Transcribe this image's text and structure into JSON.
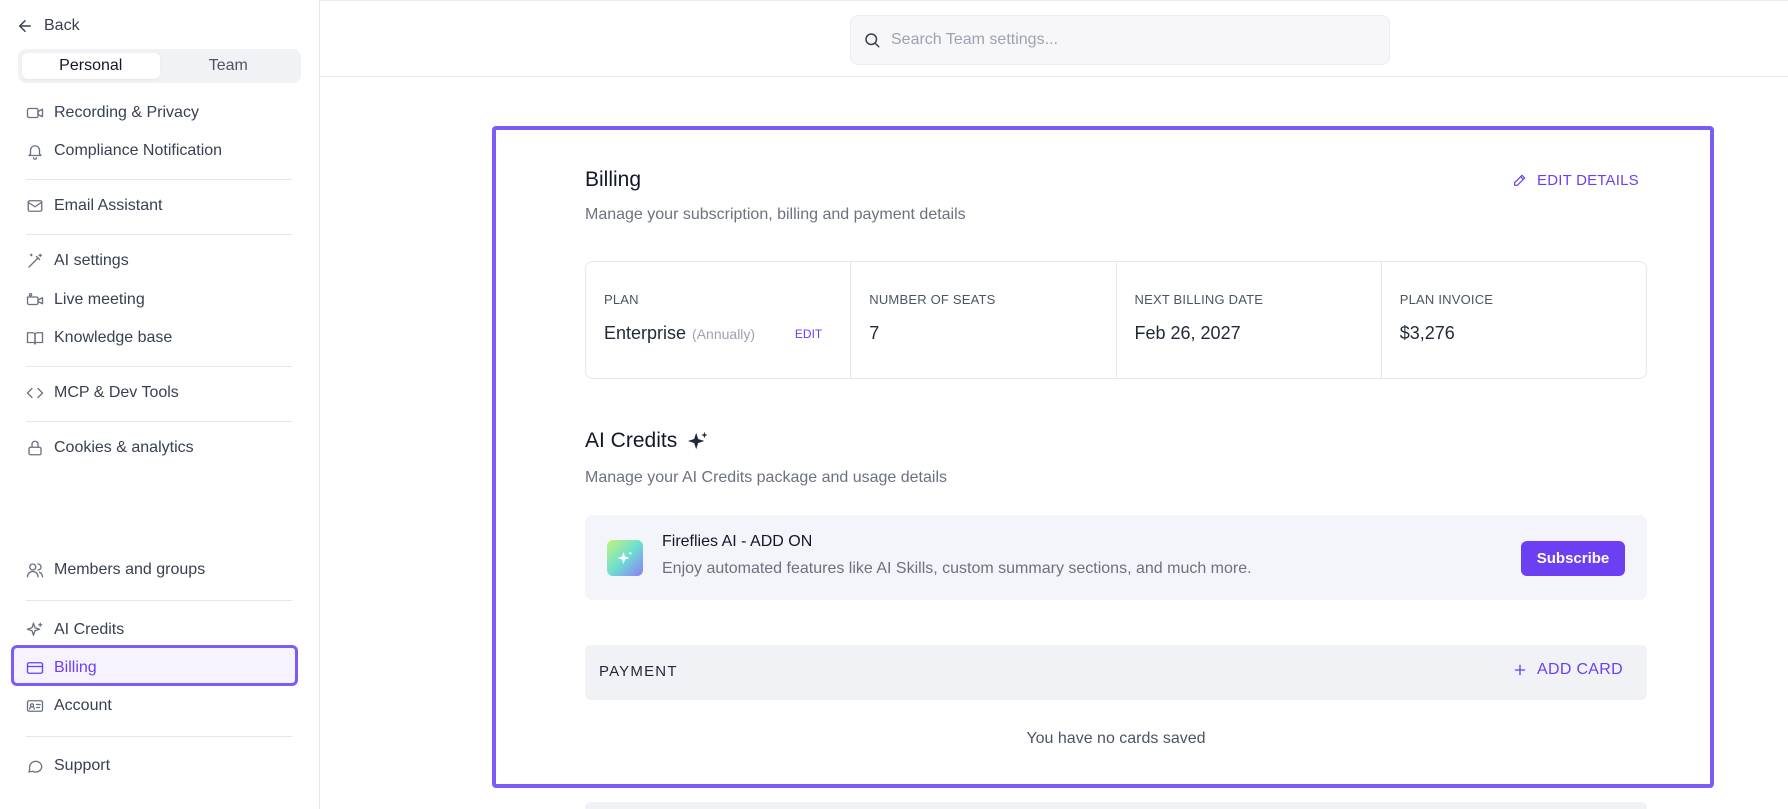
{
  "sidebar": {
    "back_label": "Back",
    "segments": [
      "Personal",
      "Team"
    ],
    "active_segment": "Personal",
    "items": [
      {
        "label": "Recording & Privacy",
        "icon": "video-icon"
      },
      {
        "label": "Compliance Notification",
        "icon": "bell-icon"
      },
      {
        "label": "Email Assistant",
        "icon": "mail-icon"
      },
      {
        "label": "AI settings",
        "icon": "magic-wand-icon"
      },
      {
        "label": "Live meeting",
        "icon": "live-camera-icon"
      },
      {
        "label": "Knowledge base",
        "icon": "book-icon"
      },
      {
        "label": "MCP & Dev Tools",
        "icon": "code-icon"
      },
      {
        "label": "Cookies & analytics",
        "icon": "lock-icon"
      },
      {
        "label": "Members and groups",
        "icon": "users-icon"
      },
      {
        "label": "AI Credits",
        "icon": "sparkle-icon"
      },
      {
        "label": "Billing",
        "icon": "credit-card-icon"
      },
      {
        "label": "Account",
        "icon": "id-card-icon"
      },
      {
        "label": "Support",
        "icon": "chat-icon"
      }
    ],
    "active_item": "Billing"
  },
  "search": {
    "placeholder": "Search Team settings..."
  },
  "billing": {
    "title": "Billing",
    "subtitle": "Manage your subscription, billing and payment details",
    "edit_details_label": "EDIT DETAILS",
    "plan": {
      "label": "PLAN",
      "value": "Enterprise",
      "period": "(Annually)",
      "edit_label": "EDIT"
    },
    "seats": {
      "label": "NUMBER OF SEATS",
      "value": "7"
    },
    "next_billing": {
      "label": "NEXT BILLING DATE",
      "value": "Feb 26, 2027"
    },
    "invoice": {
      "label": "PLAN INVOICE",
      "value": "$3,276"
    }
  },
  "ai_credits": {
    "title": "AI Credits",
    "subtitle": "Manage your AI Credits package and usage details",
    "addon": {
      "title": "Fireflies AI - ADD ON",
      "description": "Enjoy automated features like AI Skills, custom summary sections, and much more.",
      "button_label": "Subscribe"
    }
  },
  "payment": {
    "label": "PAYMENT",
    "add_card_label": "ADD CARD",
    "empty_text": "You have no cards saved"
  },
  "colors": {
    "accent": "#6d3ff2",
    "highlight_border": "#7c5cf5"
  }
}
